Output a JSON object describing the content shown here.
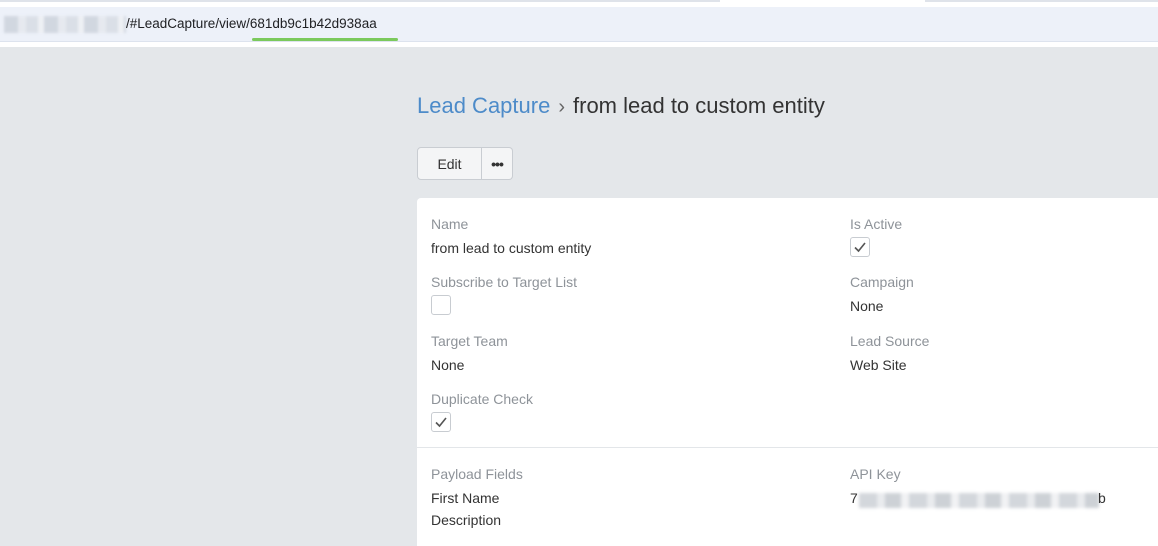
{
  "browser": {
    "url_path": "/#LeadCapture/view/681db9c1b42d938aa"
  },
  "breadcrumb": {
    "parent": "Lead Capture",
    "separator": "›",
    "current": "from lead to custom entity"
  },
  "actions": {
    "edit_label": "Edit",
    "more_label": "•••"
  },
  "fields": {
    "name": {
      "label": "Name",
      "value": "from lead to custom entity"
    },
    "is_active": {
      "label": "Is Active",
      "checked": true
    },
    "subscribe": {
      "label": "Subscribe to Target List",
      "checked": false
    },
    "campaign": {
      "label": "Campaign",
      "value": "None"
    },
    "target_team": {
      "label": "Target Team",
      "value": "None"
    },
    "lead_source": {
      "label": "Lead Source",
      "value": "Web Site"
    },
    "duplicate_check": {
      "label": "Duplicate Check",
      "checked": true
    },
    "payload_fields": {
      "label": "Payload Fields",
      "values": [
        "First Name",
        "Description"
      ]
    },
    "api_key": {
      "label": "API Key",
      "prefix": "7",
      "suffix": "b"
    }
  },
  "colors": {
    "link": "#4d8bc9",
    "page_bg": "#e4e7ea",
    "label": "#8e9399"
  }
}
